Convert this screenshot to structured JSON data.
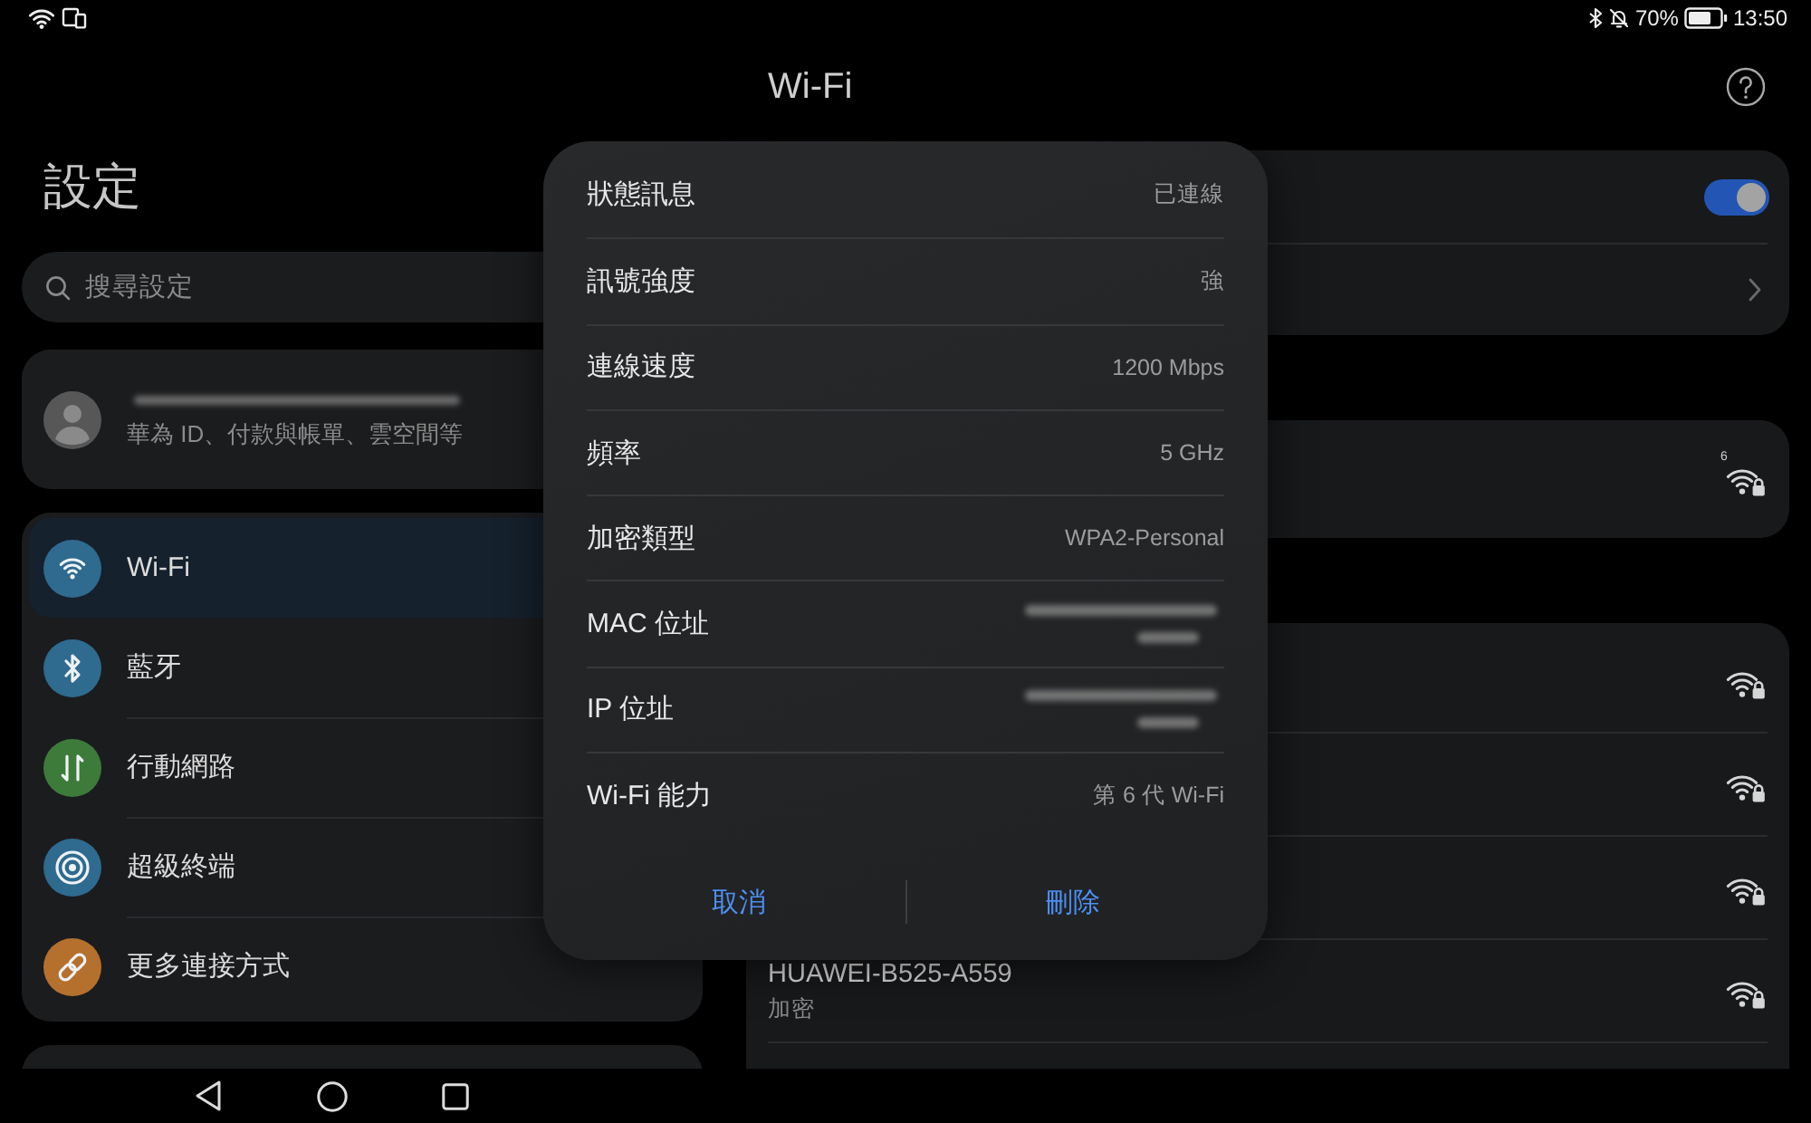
{
  "status_bar": {
    "battery": "70%",
    "time": "13:50"
  },
  "sidebar": {
    "title": "設定",
    "search": {
      "placeholder": "搜尋設定"
    },
    "account": {
      "name_blurred": true,
      "subtitle": "華為 ID、付款與帳單、雲空間等"
    },
    "items": [
      {
        "label": "Wi-Fi",
        "color": "#2f6a8f",
        "selected": true
      },
      {
        "label": "藍牙",
        "color": "#2f6a8f",
        "selected": false
      },
      {
        "label": "行動網路",
        "color": "#3d7b3a",
        "selected": false
      },
      {
        "label": "超級終端",
        "color": "#2f6a8f",
        "selected": false
      },
      {
        "label": "更多連接方式",
        "color": "#b5702e",
        "selected": false
      }
    ]
  },
  "wifi_panel": {
    "title": "Wi-Fi",
    "settings_rows": [
      {
        "kind": "switch",
        "on": true
      },
      {
        "kind": "link"
      }
    ],
    "connected_network": {
      "badge": "6",
      "secured": true
    },
    "networks": [
      {
        "secured": true
      },
      {
        "secured": true
      },
      {
        "secured": true
      },
      {
        "name": "HUAWEI-B525-A559",
        "security": "加密",
        "secured": true
      }
    ]
  },
  "dialog": {
    "rows": [
      {
        "kind": "text",
        "label": "狀態訊息",
        "value": "已連線"
      },
      {
        "kind": "text",
        "label": "訊號強度",
        "value": "強"
      },
      {
        "kind": "text",
        "label": "連線速度",
        "value": "1200 Mbps"
      },
      {
        "kind": "text",
        "label": "頻率",
        "value": "5 GHz"
      },
      {
        "kind": "text",
        "label": "加密類型",
        "value": "WPA2-Personal"
      },
      {
        "kind": "blurred",
        "label": "MAC 位址"
      },
      {
        "kind": "blurred",
        "label": "IP 位址"
      },
      {
        "kind": "text",
        "label": "Wi-Fi 能力",
        "value": "第 6 代 Wi-Fi"
      }
    ],
    "buttons": [
      "取消",
      "刪除"
    ]
  }
}
